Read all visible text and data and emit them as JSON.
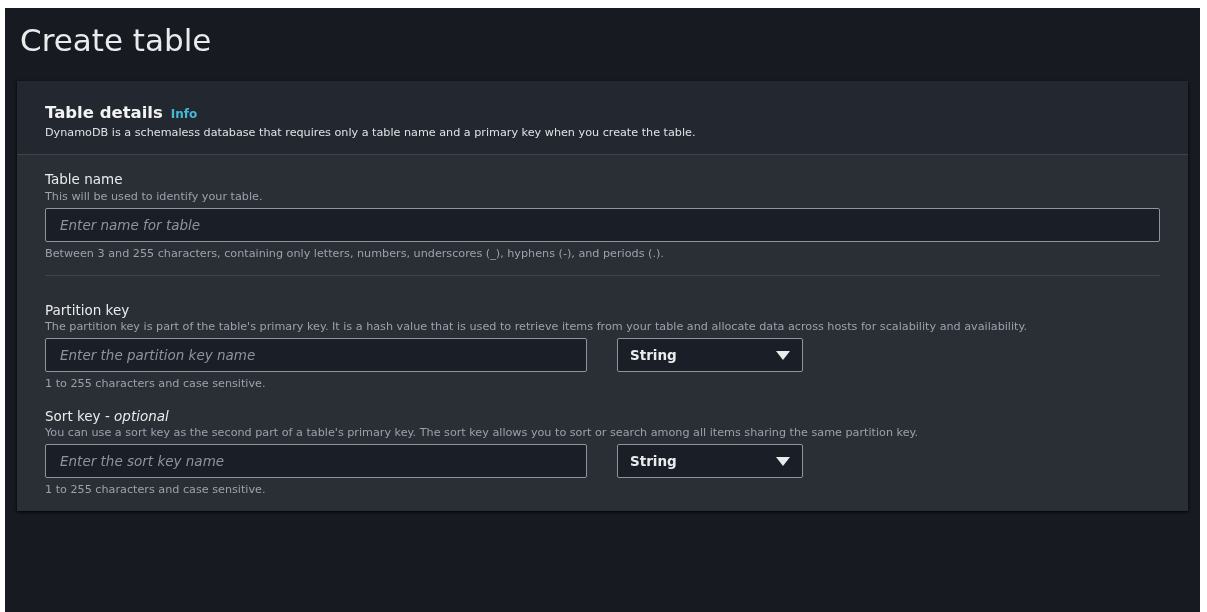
{
  "page": {
    "title": "Create table"
  },
  "panel": {
    "heading": "Table details",
    "info_link": "Info",
    "description": "DynamoDB is a schemaless database that requires only a table name and a primary key when you create the table."
  },
  "fields": [
    {
      "kind": "text",
      "label": "Table name",
      "description": "This will be used to identify your table.",
      "placeholder": "Enter name for table",
      "constraint": "Between 3 and 255 characters, containing only letters, numbers, underscores (_), hyphens (-), and periods (.)."
    },
    {
      "kind": "key",
      "label": "Partition key",
      "description": "The partition key is part of the table's primary key. It is a hash value that is used to retrieve items from your table and allocate data across hosts for scalability and availability.",
      "placeholder": "Enter the partition key name",
      "type_select": "String",
      "constraint": "1 to 255 characters and case sensitive."
    },
    {
      "kind": "key",
      "label": "Sort key - *optional*",
      "description": "You can use a sort key as the second part of a table's primary key. The sort key allows you to sort or search among all items sharing the same partition key.",
      "placeholder": "Enter the sort key name",
      "type_select": "String",
      "constraint": "1 to 255 characters and case sensitive."
    }
  ]
}
